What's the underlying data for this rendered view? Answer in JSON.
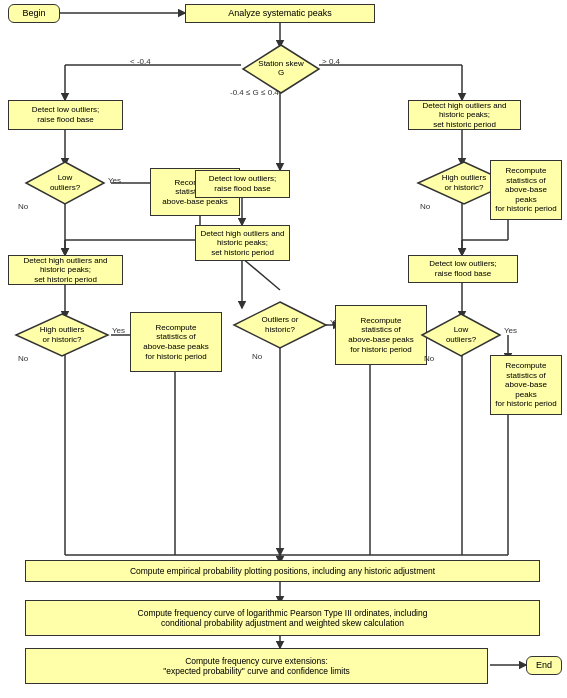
{
  "nodes": {
    "begin": "Begin",
    "analyze": "Analyze systematic peaks",
    "station_skew": "Station skew\nG",
    "detect_low_left": "Detect low outliers;\nraise flood base",
    "low_outliers_left": "Low\noutliers?",
    "recompute_left1": "Recompute\nstatistics of\nabove-base peaks",
    "detect_high_left": "Detect high outliers and\nhistoric peaks;\nset historic period",
    "high_or_historic_left": "High outliers\nor historic?",
    "recompute_left2": "Recompute\nstatistics of\nabove-base peaks\nfor historic period",
    "detect_low_mid": "Detect low outliers;\nraise flood base",
    "detect_high_mid": "Detect high outliers and\nhistoric peaks;\nset historic period",
    "outliers_historic_mid": "Outliers or\nhistoric?",
    "recompute_mid": "Recompute\nstatistics of\nabove-base peaks\nfor historic period",
    "detect_high_right": "Detect high outliers and\nhistoric peaks;\nset historic period",
    "high_or_historic_right": "High outliers\nor historic?",
    "recompute_right1": "Recompute\nstatistics of\nabove-base peaks\nfor historic period",
    "detect_low_right": "Detect low outliers;\nraise flood base",
    "low_outliers_right": "Low\noutliers?",
    "recompute_right2": "Recompute\nstatistics of\nabove-base peaks\nfor historic period",
    "compute_empirical": "Compute empirical probability plotting positions, including any historic adjustment",
    "compute_freq": "Compute frequency curve of logarithmic Pearson Type III ordinates, including\nconditional probability adjustment and weighted skew calculation",
    "compute_extensions": "Compute frequency curve extensions:\n\"expected probability\" curve and confidence limits",
    "end": "End"
  },
  "labels": {
    "lt_neg04": "< -0.4",
    "neg04_to_04": "-0.4 ≤ G ≤ 0.4",
    "gt_04": "> 0.4",
    "yes": "Yes",
    "no": "No"
  }
}
